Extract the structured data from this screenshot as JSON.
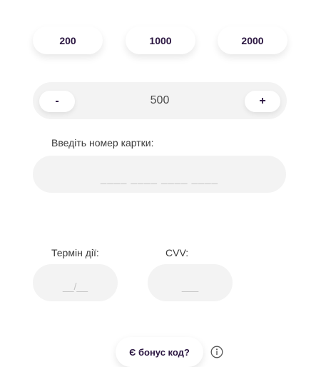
{
  "amount_presets": [
    {
      "label": "200"
    },
    {
      "label": "1000"
    },
    {
      "label": "2000"
    }
  ],
  "amount_stepper": {
    "decrement_label": "-",
    "value": "500",
    "increment_label": "+"
  },
  "card_number": {
    "label": "Введіть номер картки:",
    "placeholder": "____ ____ ____ ____",
    "value": ""
  },
  "expiry": {
    "label": "Термін дії:",
    "placeholder": "__/__",
    "value": ""
  },
  "cvv": {
    "label": "CVV:",
    "placeholder": "___",
    "value": ""
  },
  "bonus": {
    "button_label": "Є бонус код?",
    "icon": "info-icon"
  },
  "colors": {
    "accent_text": "#2a1540",
    "field_background": "#f3f3f3",
    "placeholder": "#c2c2c2"
  }
}
